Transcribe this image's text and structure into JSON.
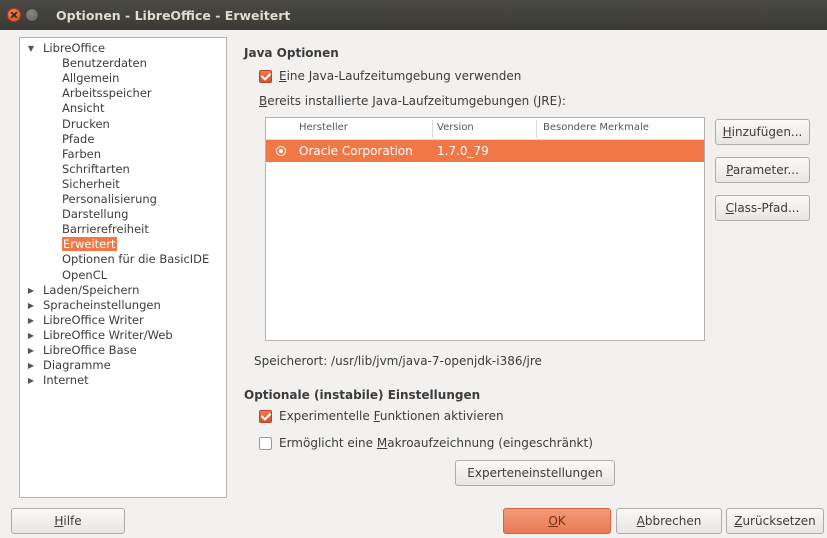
{
  "window": {
    "title": "Optionen - LibreOffice - Erweitert"
  },
  "tree": {
    "items": [
      {
        "label": "LibreOffice",
        "level": 0,
        "arrow": "▼"
      },
      {
        "label": "Benutzerdaten",
        "level": 1
      },
      {
        "label": "Allgemein",
        "level": 1
      },
      {
        "label": "Arbeitsspeicher",
        "level": 1
      },
      {
        "label": "Ansicht",
        "level": 1
      },
      {
        "label": "Drucken",
        "level": 1
      },
      {
        "label": "Pfade",
        "level": 1
      },
      {
        "label": "Farben",
        "level": 1
      },
      {
        "label": "Schriftarten",
        "level": 1
      },
      {
        "label": "Sicherheit",
        "level": 1
      },
      {
        "label": "Personalisierung",
        "level": 1
      },
      {
        "label": "Darstellung",
        "level": 1
      },
      {
        "label": "Barrierefreiheit",
        "level": 1
      },
      {
        "label": "Erweitert",
        "level": 1,
        "selected": true
      },
      {
        "label": "Optionen für die BasicIDE",
        "level": 1
      },
      {
        "label": "OpenCL",
        "level": 1
      },
      {
        "label": "Laden/Speichern",
        "level": 0,
        "arrow": "▶"
      },
      {
        "label": "Spracheinstellungen",
        "level": 0,
        "arrow": "▶"
      },
      {
        "label": "LibreOffice Writer",
        "level": 0,
        "arrow": "▶"
      },
      {
        "label": "LibreOffice Writer/Web",
        "level": 0,
        "arrow": "▶"
      },
      {
        "label": "LibreOffice Base",
        "level": 0,
        "arrow": "▶"
      },
      {
        "label": "Diagramme",
        "level": 0,
        "arrow": "▶"
      },
      {
        "label": "Internet",
        "level": 0,
        "arrow": "▶"
      }
    ]
  },
  "java": {
    "heading": "Java Optionen",
    "use_jre_pre": "E",
    "use_jre_rest": "ine Java-Laufzeitumgebung verwenden",
    "use_jre_checked": true,
    "installed_pre": "B",
    "installed_rest": "ereits installierte Java-Laufzeitumgebungen (JRE):",
    "columns": [
      "Hersteller",
      "Version",
      "Besondere Merkmale"
    ],
    "rows": [
      {
        "vendor": "Oracle Corporation",
        "version": "1.7.0_79",
        "features": ""
      }
    ],
    "location": "Speicherort: /usr/lib/jvm/java-7-openjdk-i386/jre",
    "add_pre": "H",
    "add_rest": "inzufügen...",
    "params_pre": "P",
    "params_rest": "arameter...",
    "classpath_pre": "C",
    "classpath_rest": "lass-Pfad..."
  },
  "optional": {
    "heading": "Optionale (instabile) Einstellungen",
    "experimental_a": "Experimentelle ",
    "experimental_u": "F",
    "experimental_b": "unktionen aktivieren",
    "experimental_checked": true,
    "macro_a": "Ermöglicht eine ",
    "macro_u": "M",
    "macro_b": "akroaufzeichnung (eingeschränkt)",
    "macro_checked": false,
    "expert_button": "Experteneinstellungen"
  },
  "footer": {
    "help_pre": "H",
    "help_rest": "ilfe",
    "ok_pre": "O",
    "ok_rest": "K",
    "cancel_pre": "A",
    "cancel_rest": "bbrechen",
    "reset_pre": "Z",
    "reset_rest": "urücksetzen"
  },
  "colors": {
    "accent": "#f07746",
    "titlebar": "#3c3b37",
    "background": "#f2f1f0"
  }
}
